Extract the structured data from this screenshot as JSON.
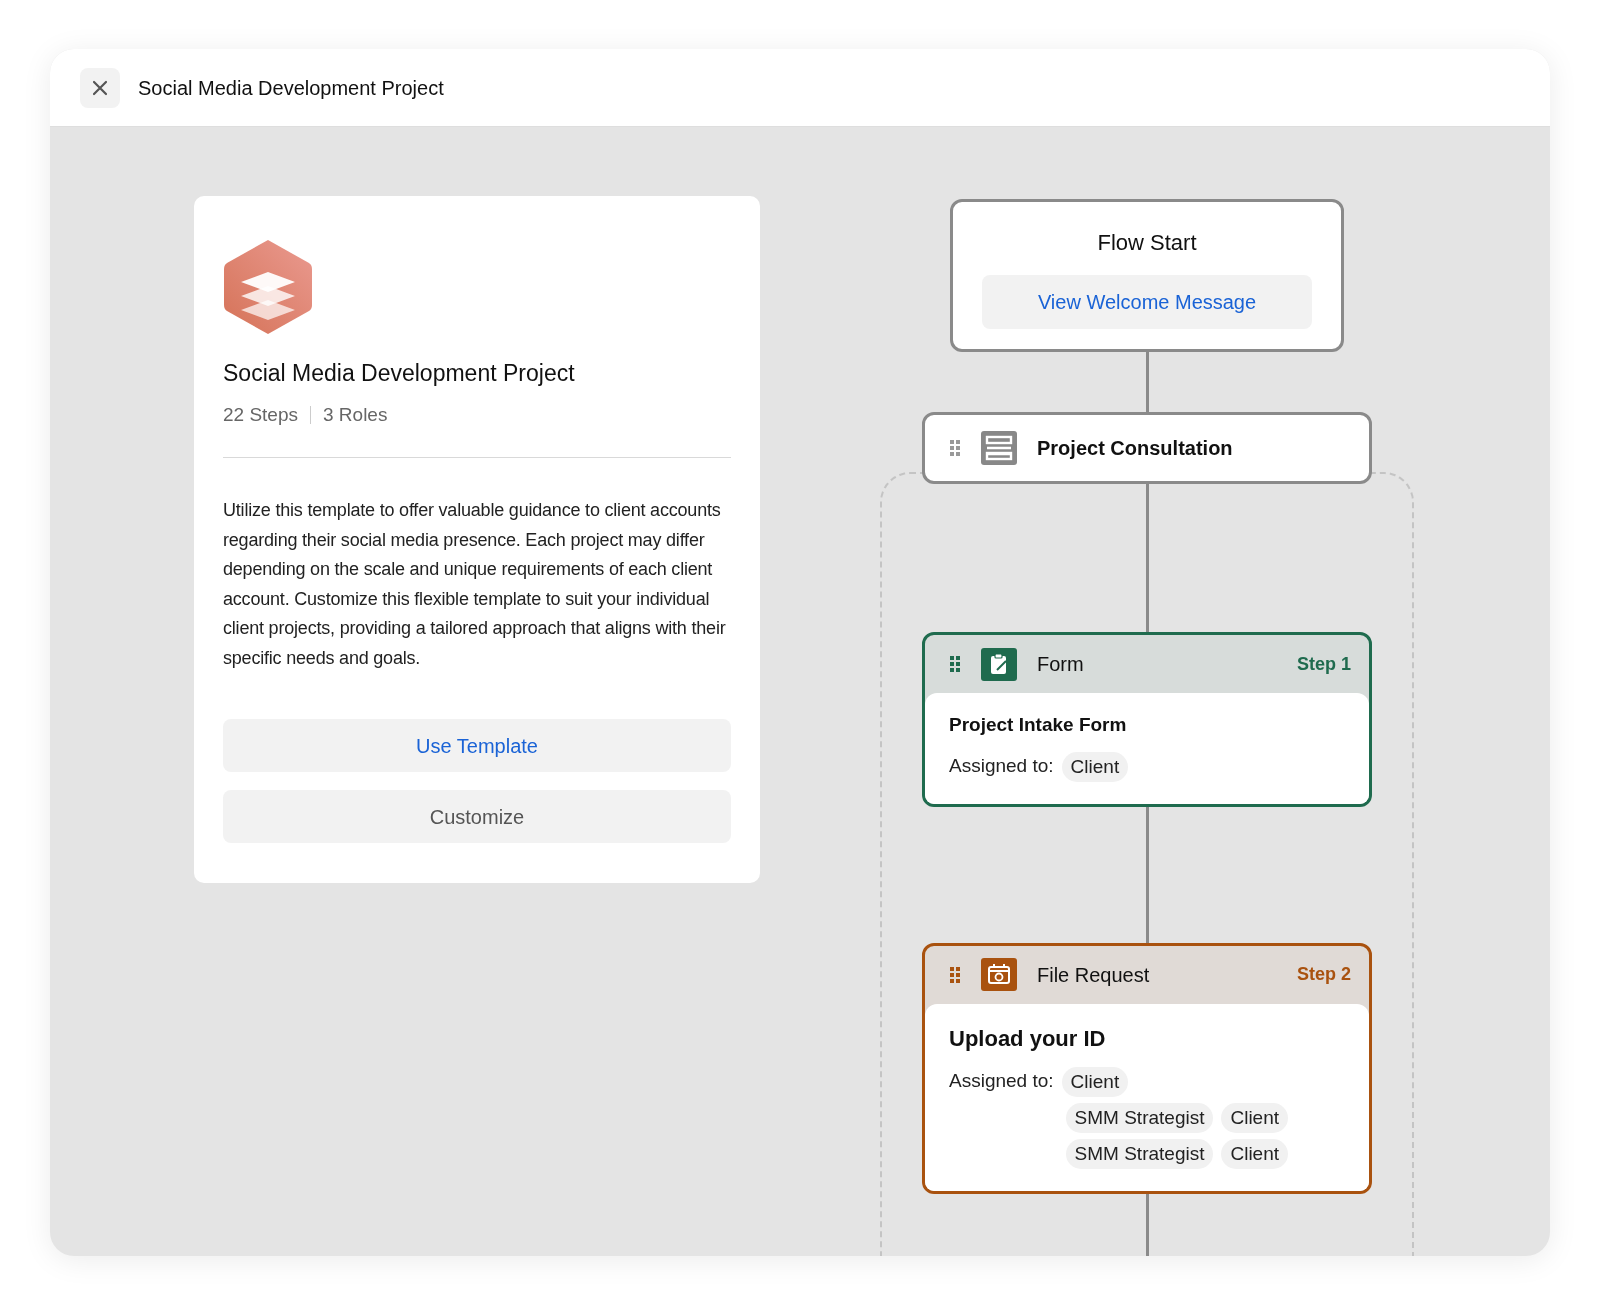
{
  "window": {
    "title": "Social Media Development Project"
  },
  "template": {
    "title": "Social Media Development Project",
    "steps": "22 Steps",
    "roles": "3 Roles",
    "description": "Utilize this template to offer valuable guidance to client accounts regarding their social media presence. Each project may differ depending on the scale and unique requirements of each client account. Customize this flexible template to suit your individual client projects, providing a tailored approach that aligns with their specific needs and goals.",
    "buttons": [
      {
        "label": "Use Template",
        "kind": "primary"
      },
      {
        "label": "Customize",
        "kind": "secondary"
      }
    ]
  },
  "flow": [
    {
      "kind": "start",
      "title": "Flow Start",
      "link": "View Welcome Message"
    },
    {
      "kind": "section",
      "title": "Project Consultation"
    },
    {
      "kind": "form_step",
      "type_label": "Form",
      "step": "Step 1",
      "color": "#1f6b4e",
      "title": "Project Intake Form",
      "assigned_label": "Assigned to:",
      "assignees": [
        [
          "Client"
        ]
      ]
    },
    {
      "kind": "file_request_step",
      "type_label": "File Request",
      "step": "Step 2",
      "color": "#a9520f",
      "title": "Upload your ID",
      "assigned_label": "Assigned to:",
      "assignees": [
        [
          "Client"
        ],
        [
          "SMM Strategist",
          "Client"
        ],
        [
          "SMM Strategist",
          "Client"
        ]
      ]
    }
  ]
}
